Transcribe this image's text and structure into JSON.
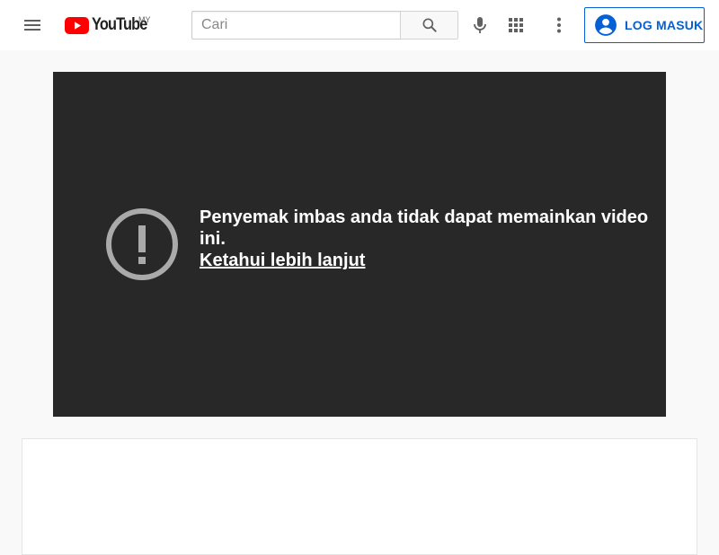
{
  "masthead": {
    "logo_text": "YouTube",
    "country_code": "MY",
    "search": {
      "placeholder": "Cari"
    },
    "signin_label": "LOG MASUK",
    "brand_color": "#ff0000",
    "accent_color": "#065fd4"
  },
  "icons": {
    "menu": "hamburger-menu-icon",
    "search": "search-icon",
    "mic": "microphone-icon",
    "apps": "apps-grid-icon",
    "more": "more-vert-icon",
    "account": "account-circle-icon",
    "error": "error-exclamation-icon"
  },
  "player": {
    "error_message": "Penyemak imbas anda tidak dapat memainkan video ini.",
    "learn_more": "Ketahui lebih lanjut"
  }
}
